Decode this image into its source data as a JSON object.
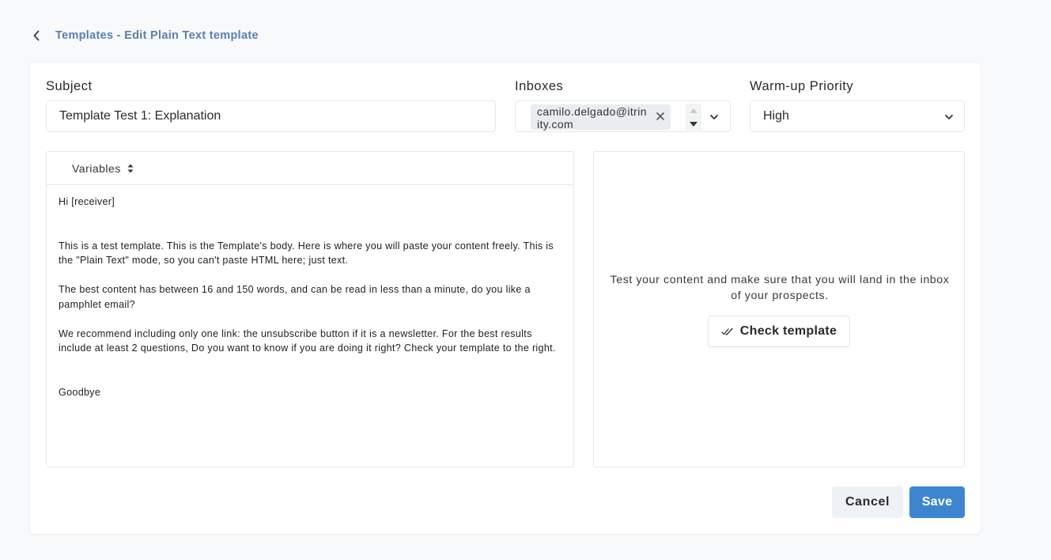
{
  "header": {
    "breadcrumb": "Templates - Edit Plain Text template",
    "back_icon": "chevron-left-icon"
  },
  "form": {
    "subject_label": "Subject",
    "subject_value": "Template Test 1: Explanation",
    "inboxes_label": "Inboxes",
    "inbox_chip": "camilo.delgado@itrinity.com",
    "warmup_label": "Warm-up Priority",
    "warmup_value": "High"
  },
  "editor": {
    "variables_label": "Variables",
    "lines": {
      "greeting": "Hi [receiver]",
      "para1": "This is a test template. This is the Template's body. Here is where you will paste your content freely. This is the \"Plain Text\" mode, so you can't paste HTML here; just text.",
      "para2": "The best content has between 16 and 150 words, and can be read in less than a minute, do you like a pamphlet email?",
      "para3": "We recommend including only one link: the unsubscribe button if it is a newsletter. For the best results include at least 2 questions, Do you want to know if you are doing it right? Check your template to the right.",
      "closing": "Goodbye"
    }
  },
  "preview": {
    "description": "Test your content and make sure that you will land in the inbox of your prospects.",
    "check_button": "Check template"
  },
  "actions": {
    "cancel": "Cancel",
    "save": "Save"
  },
  "colors": {
    "accent": "#3d86cf",
    "breadcrumb": "#5b7fae",
    "chip_bg": "#e9edf2"
  }
}
